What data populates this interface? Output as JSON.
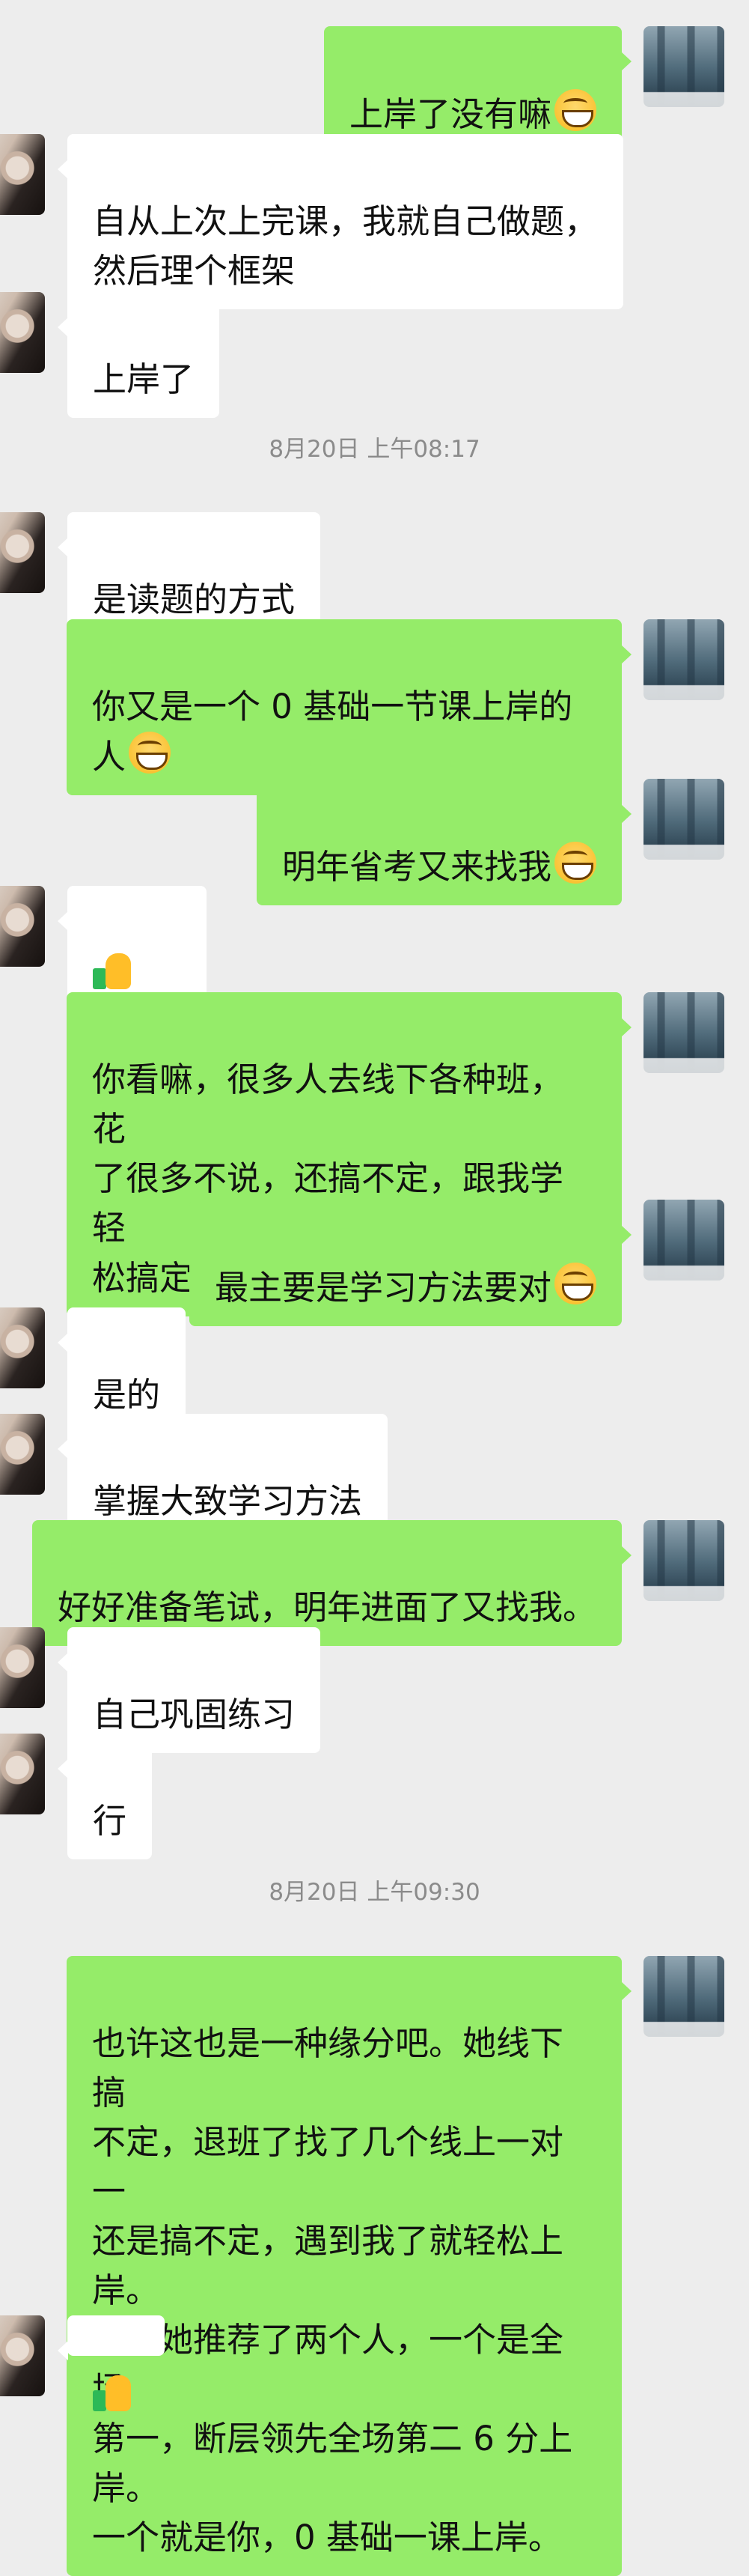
{
  "messages": [
    {
      "sender": "self",
      "text": "上岸了没有嘛",
      "emoji": "grin-emoji"
    },
    {
      "sender": "friend",
      "text": "自从上次上完课，我就自己做题，\n然后理个框架"
    },
    {
      "sender": "friend",
      "text": "上岸了"
    },
    {
      "timestamp": "8月20日 上午08:17"
    },
    {
      "sender": "friend",
      "text": "是读题的方式"
    },
    {
      "sender": "self",
      "text": "你又是一个 0 基础一节课上岸的人",
      "emoji": "grin-emoji"
    },
    {
      "sender": "self",
      "text": "明年省考又来找我",
      "emoji": "grin-emoji"
    },
    {
      "sender": "friend",
      "emojis": [
        "thumbs-up-icon",
        "ok-hand-icon"
      ]
    },
    {
      "sender": "self",
      "text": "你看嘛，很多人去线下各种班，花\n了很多不说，还搞不定，跟我学轻\n松搞定",
      "emoji": "grin-emoji"
    },
    {
      "sender": "self",
      "text": "最主要是学习方法要对",
      "emoji": "grin-emoji"
    },
    {
      "sender": "friend",
      "text": "是的"
    },
    {
      "sender": "friend",
      "text": "掌握大致学习方法"
    },
    {
      "sender": "self",
      "text": "好好准备笔试，明年进面了又找我。"
    },
    {
      "sender": "friend",
      "text": "自己巩固练习"
    },
    {
      "sender": "friend",
      "text": "行"
    },
    {
      "timestamp": "8月20日 上午09:30"
    },
    {
      "sender": "self",
      "text": "也许这也是一种缘分吧。她线下搞\n不定，退班了找了几个线上一对一\n还是搞不定，遇到我了就轻松上岸。\n然后她推荐了两个人，一个是全场\n第一，断层领先全场第二 6 分上岸。\n一个就是你，0 基础一课上岸。"
    },
    {
      "sender": "friend",
      "emojis": [
        "thumbs-up-icon"
      ]
    }
  ]
}
